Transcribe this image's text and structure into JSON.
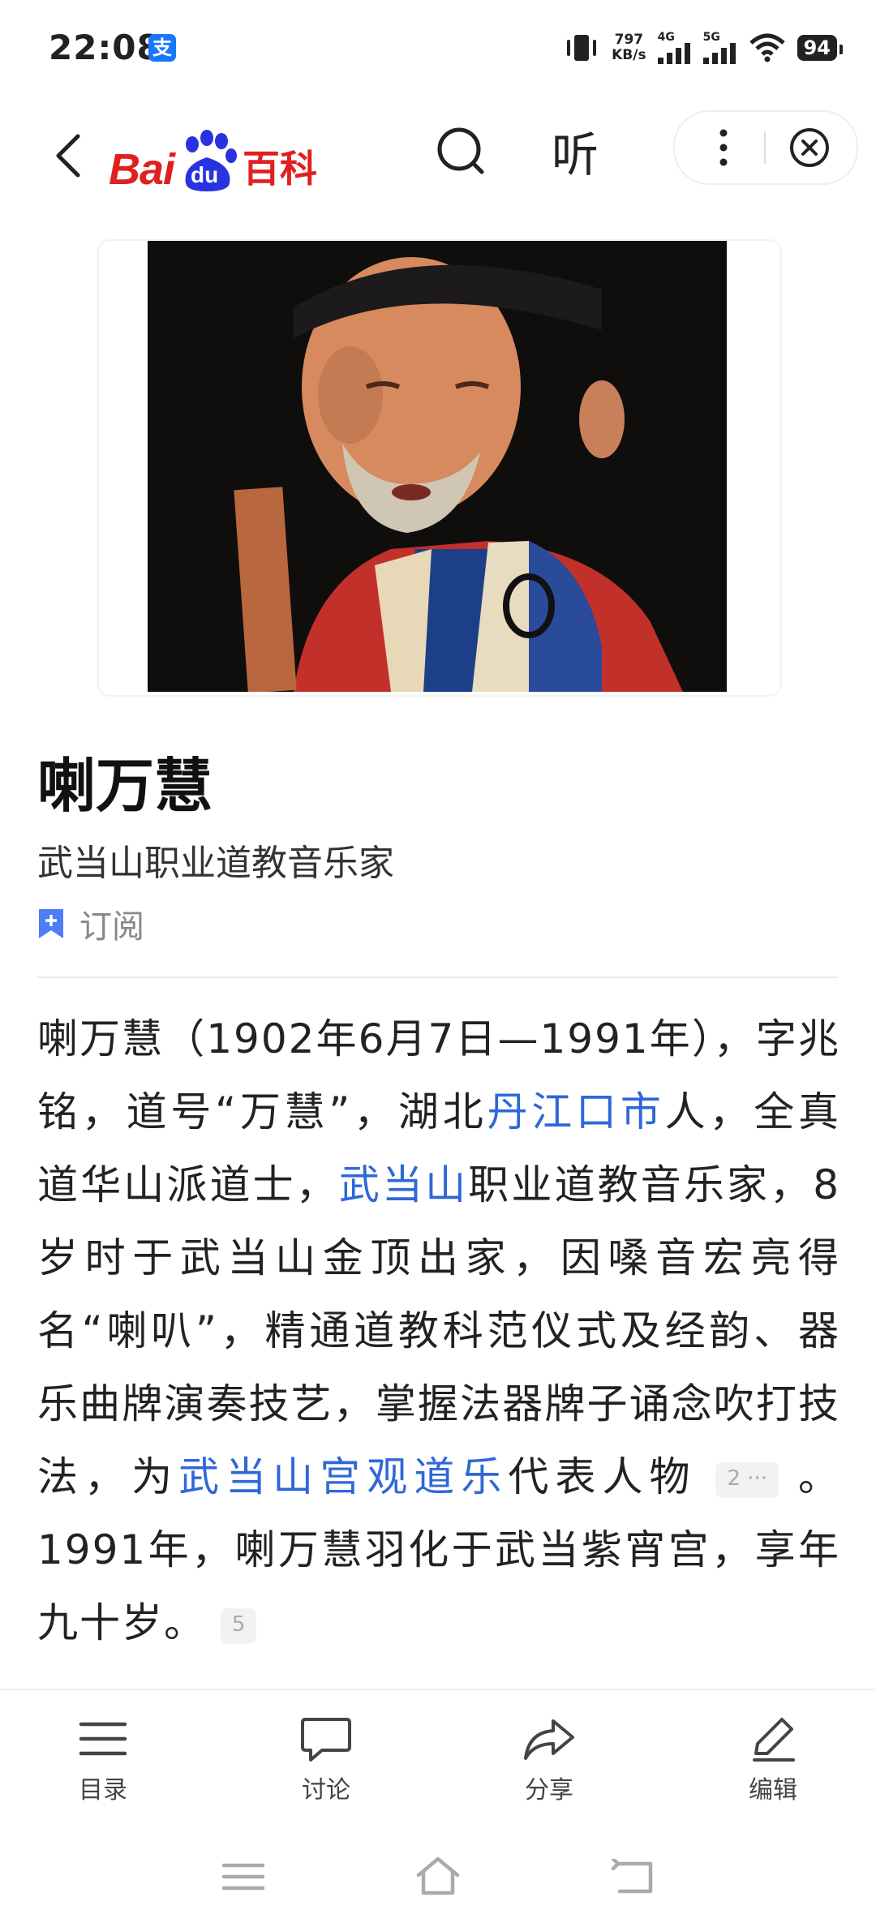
{
  "status": {
    "time": "22:08",
    "pay_badge": "支",
    "net_speed_value": "797",
    "net_speed_unit": "KB/s",
    "sim1": "4G",
    "sim2": "5G",
    "battery": "94"
  },
  "header": {
    "logo_text_bai": "Bai",
    "logo_text_du": "du",
    "logo_text_baike": "百科",
    "listen_label": "听"
  },
  "article": {
    "title": "喇万慧",
    "subtitle": "武当山职业道教音乐家",
    "subscribe_label": "订阅",
    "summary": {
      "t1": "喇万慧（1902年6月7日—1991年），字兆铭，道号“万慧”，湖北",
      "link1": "丹江口市",
      "t2": "人，全真道华山派道士，",
      "link2": "武当山",
      "t3": "职业道教音乐家，8岁时于武当山金顶出家，因嗓音宏亮得名“喇叭”，精通道教科范仪式及经韵、器乐曲牌演奏技艺，掌握法器牌子诵念吹打技法，为",
      "link3": "武当山宫观道乐",
      "t4": "代表人物",
      "ref1": "2 ···",
      "t5": "。1991年，喇万慧羽化于武当紫宵宫，享年九十岁。",
      "ref2": "5"
    }
  },
  "bottom_bar": {
    "toc": "目录",
    "discuss": "讨论",
    "share": "分享",
    "edit": "编辑"
  },
  "icons": {
    "back": "back-arrow-icon",
    "search": "search-icon",
    "more": "more-vertical-icon",
    "close": "close-circle-icon",
    "subscribe": "bookmark-plus-icon",
    "toc": "list-icon",
    "discuss": "chat-bubble-icon",
    "share": "share-arrow-icon",
    "edit": "pencil-icon"
  },
  "colors": {
    "brand_red": "#e02020",
    "brand_blue": "#2932e1",
    "link": "#2f68d6",
    "subscribe_icon": "#4f7df5"
  }
}
